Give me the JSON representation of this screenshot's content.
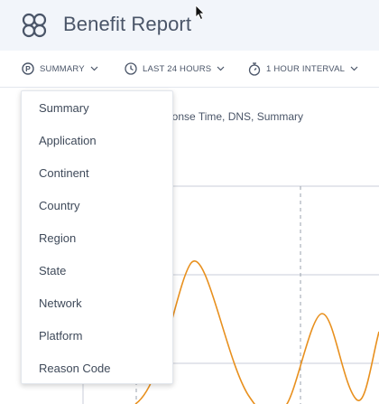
{
  "header": {
    "title": "Benefit Report"
  },
  "toolbar": {
    "summary_label": "SUMMARY",
    "range_label": "LAST 24 HOURS",
    "interval_label": "1 HOUR INTERVAL"
  },
  "chart": {
    "subtitle": "sponse Time,  DNS,  Summary"
  },
  "dropdown": {
    "items": [
      "Summary",
      "Application",
      "Continent",
      "Country",
      "Region",
      "State",
      "Network",
      "Platform",
      "Reason Code"
    ]
  },
  "colors": {
    "accent_line": "#e8901e",
    "header_bg": "#f2f5fa"
  }
}
